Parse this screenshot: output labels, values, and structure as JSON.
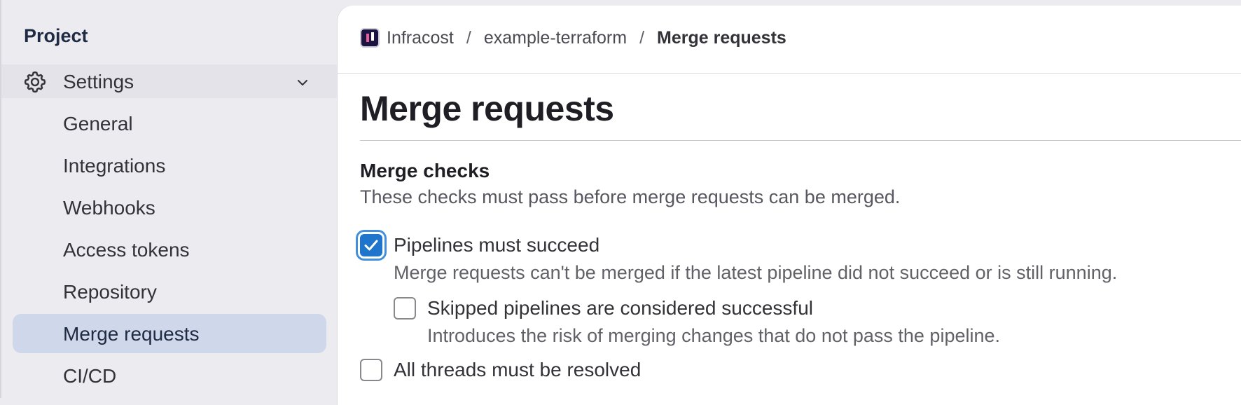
{
  "sidebar": {
    "heading": "Project",
    "settings_label": "Settings",
    "items": [
      {
        "label": "General"
      },
      {
        "label": "Integrations"
      },
      {
        "label": "Webhooks"
      },
      {
        "label": "Access tokens"
      },
      {
        "label": "Repository"
      },
      {
        "label": "Merge requests",
        "active": true
      },
      {
        "label": "CI/CD"
      }
    ]
  },
  "breadcrumb": {
    "group": "Infracost",
    "project": "example-terraform",
    "current": "Merge requests",
    "separator": "/"
  },
  "page": {
    "title": "Merge requests"
  },
  "merge_checks": {
    "title": "Merge checks",
    "description": "These checks must pass before merge requests can be merged.",
    "options": {
      "pipelines": {
        "label": "Pipelines must succeed",
        "help": "Merge requests can't be merged if the latest pipeline did not succeed or is still running.",
        "checked": true
      },
      "skipped": {
        "label": "Skipped pipelines are considered successful",
        "help": "Introduces the risk of merging changes that do not pass the pipeline.",
        "checked": false
      },
      "threads": {
        "label": "All threads must be resolved",
        "checked": false
      }
    }
  },
  "colors": {
    "accent": "#1f75cb",
    "active_nav_bg": "#cfd8ea",
    "sidebar_bg": "#ecebf0"
  },
  "icons": {
    "settings": "gear-icon",
    "expand": "chevron-down-icon",
    "group_logo": "infracost-logo-icon",
    "checkbox": "check-icon"
  }
}
